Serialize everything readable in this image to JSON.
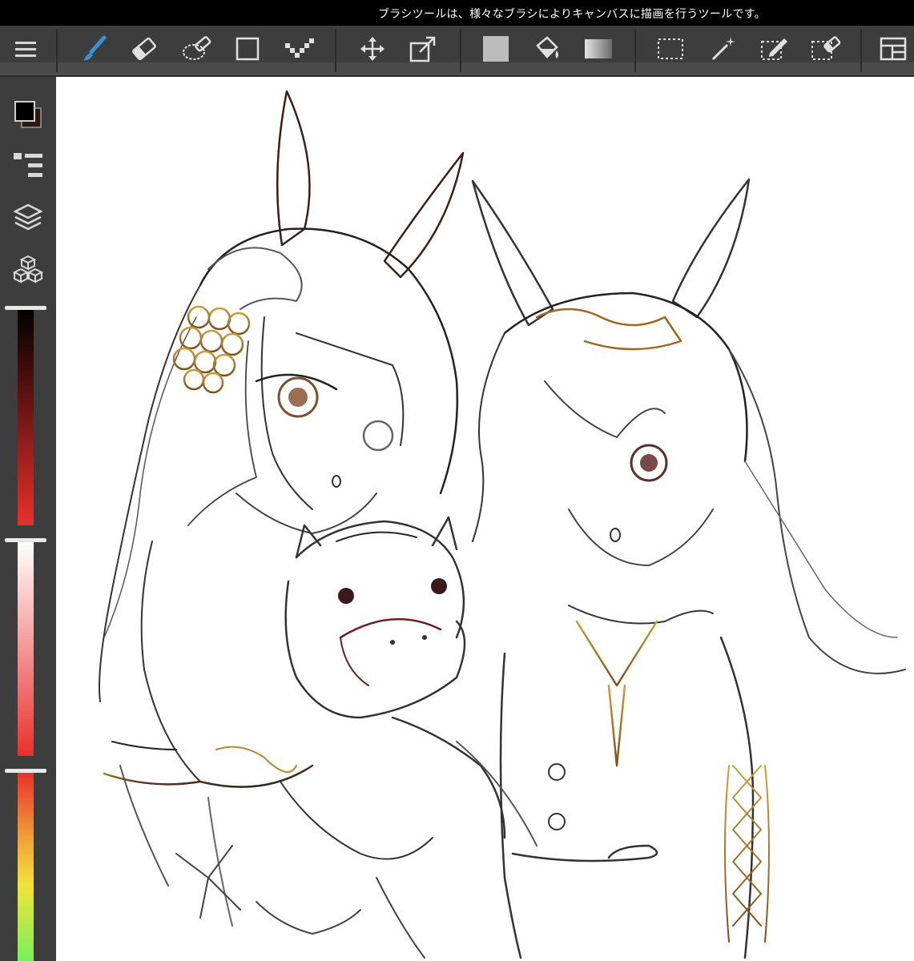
{
  "status_bar": {
    "tooltip": "ブラシツールは、様々なブラシによりキャンバスに描画を行うツールです。"
  },
  "toolbar": {
    "tools": [
      {
        "name": "menu-icon"
      },
      {
        "name": "brush-tool-icon",
        "active": true
      },
      {
        "name": "eraser-tool-icon"
      },
      {
        "name": "lasso-eraser-tool-icon"
      },
      {
        "name": "shape-tool-icon"
      },
      {
        "name": "dot-tool-icon"
      },
      {
        "name": "move-tool-icon"
      },
      {
        "name": "transform-tool-icon"
      },
      {
        "name": "fill-color-icon"
      },
      {
        "name": "bucket-tool-icon"
      },
      {
        "name": "gradient-tool-icon"
      },
      {
        "name": "select-tool-icon"
      },
      {
        "name": "magic-wand-tool-icon"
      },
      {
        "name": "select-pen-tool-icon"
      },
      {
        "name": "select-eraser-tool-icon"
      },
      {
        "name": "layout-icon"
      }
    ]
  },
  "sidebar": {
    "buttons": [
      {
        "name": "color-swatch-icon",
        "foreground": "#000000",
        "background": "#2a1a14"
      },
      {
        "name": "brush-list-icon"
      },
      {
        "name": "layers-icon"
      },
      {
        "name": "materials-icon"
      }
    ],
    "sliders": [
      {
        "name": "hue-slider",
        "colors": [
          "#000000",
          "#e8302b"
        ],
        "value": 0
      },
      {
        "name": "saturation-slider",
        "colors": [
          "#ffffff",
          "#e8302b"
        ],
        "value": 0
      },
      {
        "name": "brightness-slider",
        "colors": [
          "#e8302b",
          "#f4e23a",
          "#78f05a"
        ],
        "value": 0
      }
    ]
  },
  "colors": {
    "accent": "#3a8fd8",
    "toolbar_bg": "#3d3d3d",
    "canvas_bg": "#ffffff"
  }
}
